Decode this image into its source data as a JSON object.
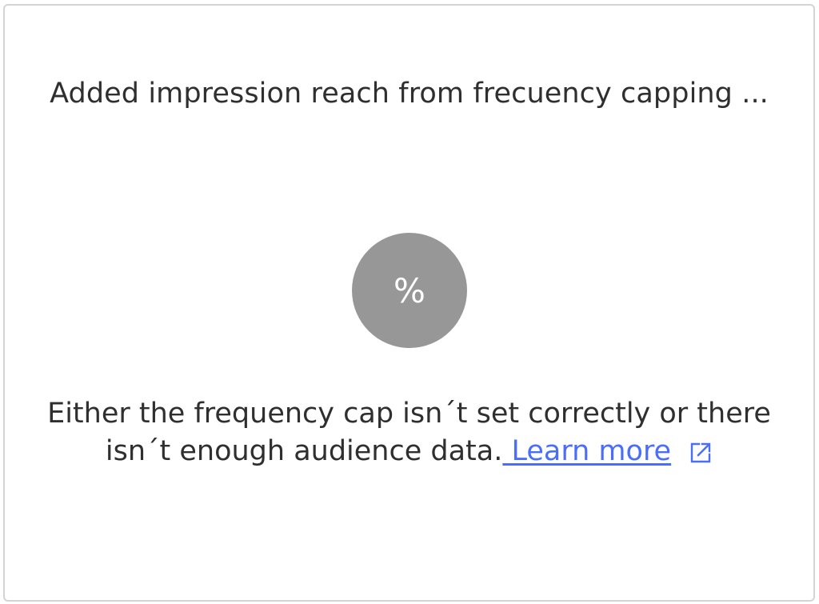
{
  "card": {
    "title": "Added impression reach from frecuency capping ...",
    "metric_symbol": "%",
    "message_line1": "Either the frequency cap isn´t set correctly or there",
    "message_line2": "isn´t enough audience data.",
    "learn_more_label": " Learn more",
    "external_link_icon": "external-link-icon"
  },
  "colors": {
    "border": "#d4d4d4",
    "text": "#2f2f2f",
    "circle": "#979797",
    "link": "#4a6ef7"
  }
}
